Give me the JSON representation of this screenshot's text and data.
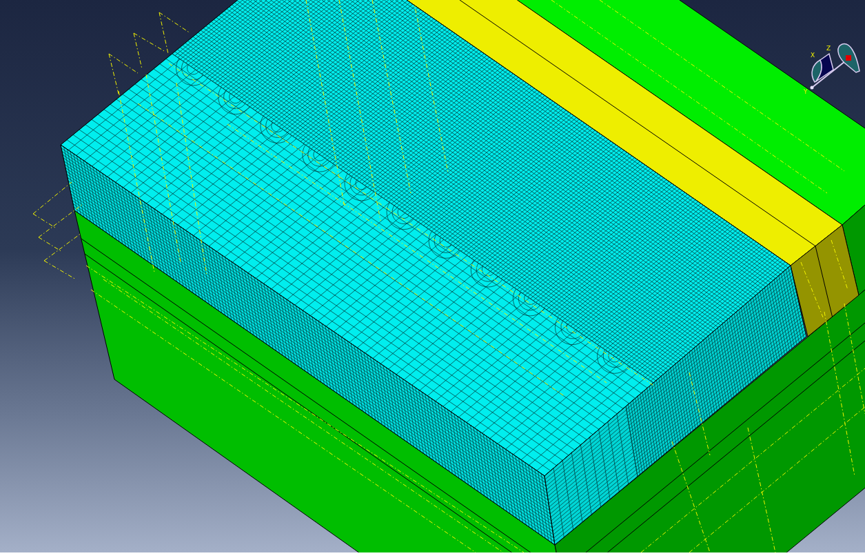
{
  "viewport": {
    "parts": [
      {
        "kind": "mesh-layer",
        "color": "#00eeee",
        "meshed": true
      },
      {
        "kind": "strip",
        "color": "#eeee00",
        "meshed": false
      },
      {
        "kind": "ground",
        "color": "#00ee00",
        "meshed": false
      }
    ],
    "triad": {
      "axis_labels": [
        "X",
        "Z",
        "Y"
      ]
    }
  }
}
